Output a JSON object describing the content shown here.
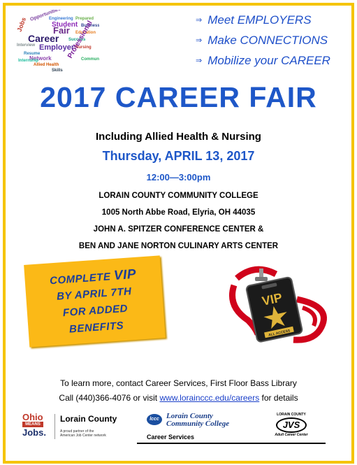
{
  "wordcloud": {
    "words": [
      "Career",
      "Fair",
      "Student",
      "Employer",
      "Professional",
      "Network",
      "Opportunities",
      "Jobs",
      "Allied Health",
      "Nursing",
      "Business",
      "Engineering",
      "Prepared",
      "Internship",
      "Community",
      "Resume",
      "Education",
      "Success",
      "Interview",
      "Skills"
    ]
  },
  "bullets": [
    "Meet EMPLOYERS",
    "Make CONNECTIONS",
    "Mobilize your CAREER"
  ],
  "title": "2017 CAREER FAIR",
  "subtitle": "Including Allied Health & Nursing",
  "date": "Thursday, APRIL 13, 2017",
  "time": "12:00—3:00pm",
  "address": [
    "LORAIN COUNTY COMMUNITY COLLEGE",
    "1005 North Abbe Road, Elyria, OH 44035",
    "JOHN A. SPITZER CONFERENCE CENTER &",
    "BEN AND JANE NORTON CULINARY ARTS CENTER"
  ],
  "vip_callout": {
    "line1_prefix": "COMPLETE ",
    "line1_vip": "VIP",
    "line2": "BY APRIL 7TH",
    "line3": "FOR ADDED",
    "line4": "BENEFITS"
  },
  "vip_badge": {
    "text": "VIP",
    "sub": "ALL ACCESS"
  },
  "info": {
    "line1": "To learn more, contact Career Services, First Floor Bass Library",
    "line2_prefix": "Call (440)366-4076 or visit ",
    "link": "www.lorainccc.edu/careers",
    "line2_suffix": " for details"
  },
  "logos": {
    "ohio_top": "Ohio",
    "ohio_mid": "MEANS",
    "ohio_bottom": "Jobs.",
    "lc_title": "Lorain County",
    "lc_sub1": "A proud partner of the",
    "lc_sub2": "American Job Center network",
    "lccc_mark": "lccc",
    "lccc_line1": "Lorain County",
    "lccc_line2": "Community College",
    "lccc_dept": "Career Services",
    "jvs_top": "LORAIN COUNTY",
    "jvs_mark": "JVS",
    "jvs_bottom": "Adult Career Center"
  },
  "colors": {
    "border": "#f5c400",
    "blue": "#1e57c8",
    "gold": "#fbb917",
    "red": "#d0021b"
  }
}
